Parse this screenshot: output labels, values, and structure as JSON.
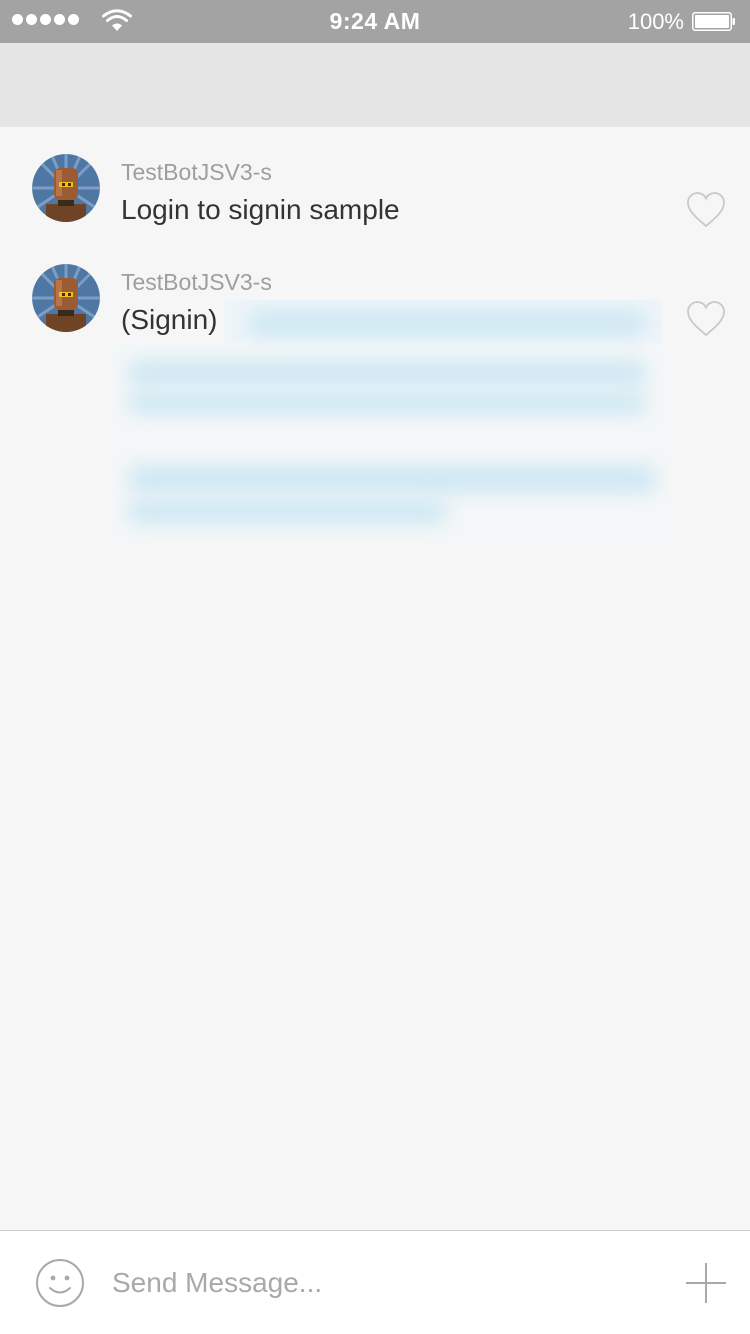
{
  "status_bar": {
    "time": "9:24 AM",
    "battery": "100%",
    "signal_icon": "signal-dots-icon",
    "wifi_icon": "wifi-icon",
    "battery_icon": "battery-icon"
  },
  "messages": [
    {
      "sender": "TestBotJSV3-s",
      "text": "Login to signin sample",
      "avatar_icon": "robot-avatar",
      "like_icon": "heart-icon"
    },
    {
      "sender": "TestBotJSV3-s",
      "text": "(Signin)",
      "avatar_icon": "robot-avatar",
      "like_icon": "heart-icon"
    }
  ],
  "composer": {
    "placeholder": "Send Message...",
    "emoji_icon": "smiley-icon",
    "add_icon": "plus-icon"
  },
  "colors": {
    "status_bar": "#a3a3a3",
    "header": "#e5e5e5",
    "background": "#f6f6f6",
    "sender_text": "#9e9e9e",
    "message_text": "#333333",
    "blurred_content": "#cfe8f3"
  }
}
